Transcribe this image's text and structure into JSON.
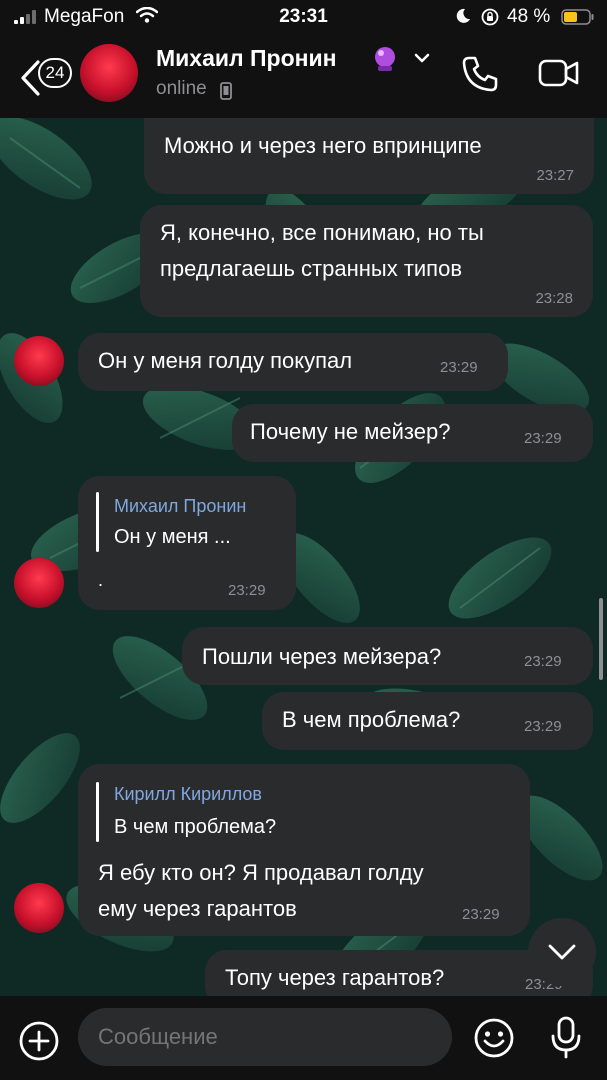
{
  "status_bar": {
    "carrier": "MegaFon",
    "time": "23:31",
    "battery": "48 %"
  },
  "header": {
    "back_badge": "24",
    "contact_name": "Михаил Пронин",
    "status": "online"
  },
  "messages": [
    {
      "side": "out",
      "text_lines": [
        "Можно и через него впринципе"
      ],
      "time": "23:27"
    },
    {
      "side": "out",
      "text_lines": [
        "Я, конечно, все понимаю, но ты",
        "предлагаешь странных типов"
      ],
      "time": "23:28"
    },
    {
      "side": "in",
      "text_lines": [
        "Он у меня голду покупал"
      ],
      "time": "23:29"
    },
    {
      "side": "out",
      "text_lines": [
        "Почему не мейзер?"
      ],
      "time": "23:29"
    },
    {
      "side": "in",
      "reply_author": "Михаил Пронин",
      "reply_text": "Он у меня ...",
      "text_lines": [
        "."
      ],
      "time": "23:29"
    },
    {
      "side": "out",
      "text_lines": [
        "Пошли через мейзера?"
      ],
      "time": "23:29"
    },
    {
      "side": "out",
      "text_lines": [
        "В чем проблема?"
      ],
      "time": "23:29"
    },
    {
      "side": "in",
      "reply_author": "Кирилл Кириллов",
      "reply_text": "В чем проблема?",
      "text_lines": [
        "Я ебу кто он? Я продавал голду",
        "ему через гарантов"
      ],
      "time": "23:29"
    },
    {
      "side": "out",
      "text_lines": [
        "Топу через гарантов?"
      ],
      "time": "23:29"
    }
  ],
  "composer": {
    "placeholder": "Сообщение"
  },
  "icons": {
    "back": "chevron-left-icon",
    "call": "phone-icon",
    "video": "video-camera-icon",
    "attach": "plus-circle-icon",
    "emoji": "smile-icon",
    "mic": "microphone-icon",
    "scroll_down": "chevron-down-icon"
  },
  "colors": {
    "bubble": "#2a2b2d",
    "bar": "#111112",
    "reply_author": "#7fa7e0",
    "secondary_text": "#8e8e93",
    "wallpaper": "#0f2a24"
  }
}
